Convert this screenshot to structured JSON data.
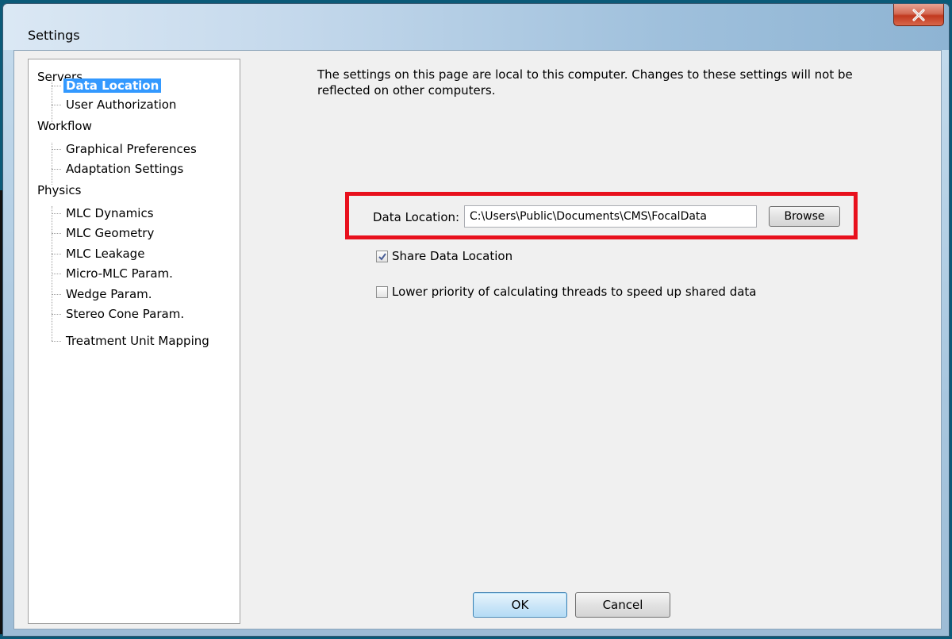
{
  "window": {
    "title": "Settings",
    "close_icon": "close-icon"
  },
  "nav": {
    "groups": [
      {
        "label": "Servers",
        "children": [
          {
            "label": "Data Location",
            "selected": true
          },
          {
            "label": "User Authorization",
            "selected": false
          }
        ]
      },
      {
        "label": "Workflow",
        "children": [
          {
            "label": "Graphical Preferences",
            "selected": false
          },
          {
            "label": "Adaptation Settings",
            "selected": false
          }
        ]
      },
      {
        "label": "Physics",
        "children": [
          {
            "label": "MLC Dynamics",
            "selected": false
          },
          {
            "label": "MLC Geometry",
            "selected": false
          },
          {
            "label": "MLC Leakage",
            "selected": false
          },
          {
            "label": "Micro-MLC Param.",
            "selected": false
          },
          {
            "label": "Wedge Param.",
            "selected": false
          },
          {
            "label": "Stereo Cone Param.",
            "selected": false
          },
          {
            "label": "Treatment Unit Mapping",
            "selected": false
          }
        ]
      }
    ]
  },
  "main": {
    "description_line1": "The settings on this page are local to this computer.  Changes to these settings will not be",
    "description_line2": "reflected on other computers.",
    "data_location_label": "Data Location:",
    "data_location_value": "C:\\Users\\Public\\Documents\\CMS\\FocalData",
    "browse_label": "Browse",
    "share_label": "Share Data Location",
    "share_checked": true,
    "lower_priority_label": "Lower priority of calculating threads to speed up shared data",
    "lower_priority_checked": false
  },
  "footer": {
    "ok_label": "OK",
    "cancel_label": "Cancel"
  },
  "colors": {
    "highlight": "#e8101d",
    "selection": "#3399ff"
  }
}
